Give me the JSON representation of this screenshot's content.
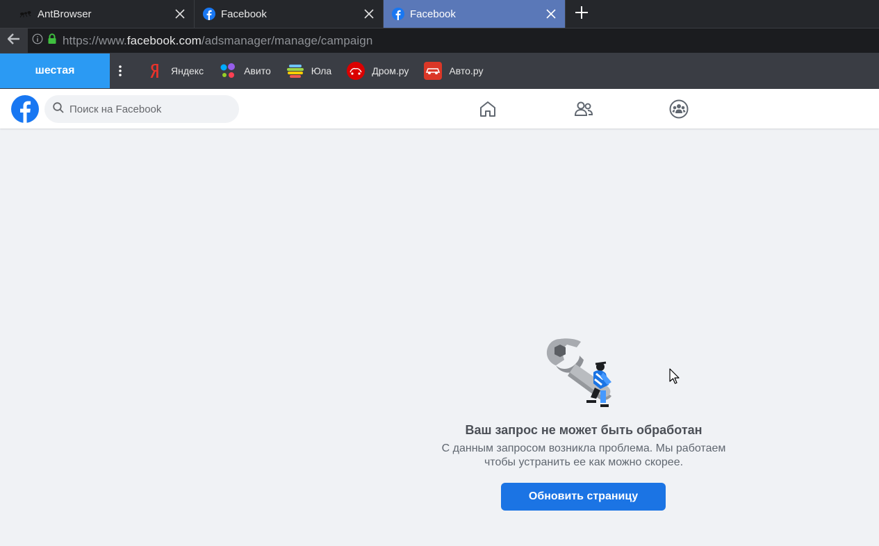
{
  "browser": {
    "tabs": [
      {
        "title": "AntBrowser",
        "favicon": "ant-icon",
        "active": false
      },
      {
        "title": "Facebook",
        "favicon": "facebook-icon",
        "active": false
      },
      {
        "title": "Facebook",
        "favicon": "facebook-icon",
        "active": true
      }
    ],
    "url_prefix": "https://www.",
    "url_host": "facebook.com",
    "url_path": "/adsmanager/manage/campaign"
  },
  "bookmarks": {
    "profile": "шестая",
    "items": [
      {
        "label": "Яндекс",
        "icon": "yandex-icon"
      },
      {
        "label": "Авито",
        "icon": "avito-icon"
      },
      {
        "label": "Юла",
        "icon": "yula-icon"
      },
      {
        "label": "Дром.ру",
        "icon": "drom-icon"
      },
      {
        "label": "Авто.ру",
        "icon": "autoru-icon"
      }
    ]
  },
  "facebook": {
    "search_placeholder": "Поиск на Facebook",
    "brand_color": "#1877f2"
  },
  "error": {
    "title": "Ваш запрос не может быть обработан",
    "description_line1": "С данным запросом возникла проблема. Мы работаем",
    "description_line2": "чтобы устранить ее как можно скорее.",
    "button": "Обновить страницу"
  }
}
